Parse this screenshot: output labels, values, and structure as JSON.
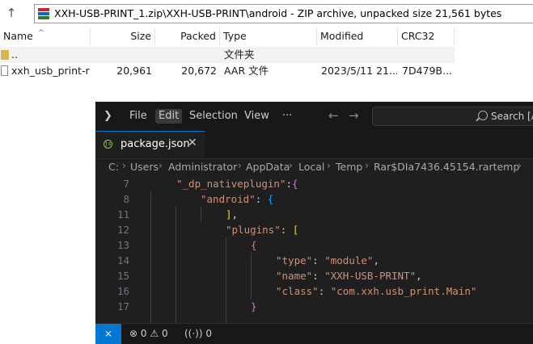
{
  "archive": {
    "address": "XXH-USB-PRINT_1.zip\\XXH-USB-PRINT\\android - ZIP archive, unpacked size 21,561 bytes",
    "columns": [
      "Name",
      "Size",
      "Packed",
      "Type",
      "Modified",
      "CRC32"
    ],
    "rows": [
      {
        "name": "..",
        "size": "",
        "packed": "",
        "type": "文件夹",
        "modified": "",
        "crc": ""
      },
      {
        "name": "xxh_usb_print-r...",
        "size": "20,961",
        "packed": "20,672",
        "type": "AAR 文件",
        "modified": "2023/5/11 21...",
        "crc": "7D479B..."
      }
    ],
    "colors": {
      "icon_red": "#c62828",
      "icon_blue": "#1565c0",
      "icon_green": "#2e7d32"
    }
  },
  "vscode": {
    "menu": [
      "File",
      "Edit",
      "Selection",
      "View",
      "···"
    ],
    "search_placeholder": "Search [Ad",
    "tab": {
      "label": "package.json",
      "close": "✕"
    },
    "breadcrumb": [
      "C:",
      "Users",
      "Administrator",
      "AppData",
      "Local",
      "Temp",
      "Rar$DIa7436.45154.rartemp"
    ],
    "lines": [
      {
        "n": "7",
        "parts": [
          [
            "k",
            "\"_dp_nativeplugin\""
          ],
          [
            "p",
            ":"
          ],
          [
            "b2",
            "{"
          ]
        ]
      },
      {
        "n": "8",
        "parts": [
          [
            "k",
            "\"android\""
          ],
          [
            "p",
            ": "
          ],
          [
            "b3",
            "{"
          ]
        ]
      },
      {
        "n": "11",
        "parts": [
          [
            "b1",
            "]"
          ],
          [
            "p",
            ","
          ]
        ]
      },
      {
        "n": "12",
        "parts": [
          [
            "k",
            "\"plugins\""
          ],
          [
            "p",
            ": "
          ],
          [
            "b1",
            "["
          ]
        ]
      },
      {
        "n": "13",
        "parts": [
          [
            "b2",
            "{"
          ]
        ]
      },
      {
        "n": "14",
        "parts": [
          [
            "k",
            "\"type\""
          ],
          [
            "p",
            ": "
          ],
          [
            "k",
            "\"module\""
          ],
          [
            "p",
            ","
          ]
        ]
      },
      {
        "n": "15",
        "parts": [
          [
            "k",
            "\"name\""
          ],
          [
            "p",
            ": "
          ],
          [
            "k",
            "\"XXH-USB-PRINT\""
          ],
          [
            "p",
            ","
          ]
        ]
      },
      {
        "n": "16",
        "parts": [
          [
            "k",
            "\"class\""
          ],
          [
            "p",
            ": "
          ],
          [
            "k",
            "\"com.xxh.usb_print.Main\""
          ]
        ]
      },
      {
        "n": "17",
        "parts": [
          [
            "b2",
            "}"
          ]
        ]
      }
    ],
    "status": {
      "errors": "0",
      "warnings": "0",
      "ports": "0"
    },
    "colors": {
      "accent": "#0078d4",
      "string": "#ce9178",
      "background": "#1f1f1f"
    }
  }
}
